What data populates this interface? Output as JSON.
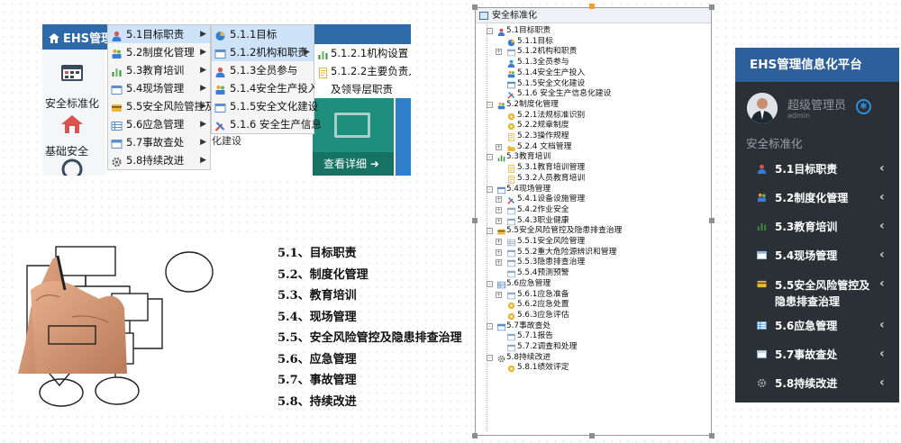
{
  "panel_menu": {
    "brand": "EHS管理",
    "nav": [
      {
        "label": "安全标准化",
        "icon": "calendar-icon"
      },
      {
        "label": "基础安全",
        "icon": "home-icon"
      }
    ],
    "menu_level1": [
      {
        "label": "5.1目标职责",
        "icon": "person-icon",
        "highlight": true
      },
      {
        "label": "5.2制度化管理",
        "icon": "people-icon",
        "highlight": false
      },
      {
        "label": "5.3教育培训",
        "icon": "bar-chart-icon",
        "highlight": false
      },
      {
        "label": "5.4现场管理",
        "icon": "window-icon",
        "highlight": false
      },
      {
        "label": "5.5安全风险管控及",
        "icon": "card-icon",
        "highlight": false
      },
      {
        "label": "5.6应急管理",
        "icon": "table-icon",
        "highlight": false
      },
      {
        "label": "5.7事故查处",
        "icon": "list-icon",
        "highlight": false
      },
      {
        "label": "5.8持续改进",
        "icon": "gear-icon",
        "highlight": false
      }
    ],
    "menu_level2": [
      {
        "label": "5.1.1目标",
        "icon": "pie-icon"
      },
      {
        "label": "5.1.2机构和职责",
        "icon": "window-icon"
      },
      {
        "label": "5.1.3全员参与",
        "icon": "person-icon"
      },
      {
        "label": "5.1.4安全生产投入",
        "icon": "people-icon"
      },
      {
        "label": "5.1.5安全文化建设",
        "icon": "window-icon"
      },
      {
        "label": "5.1.6 安全生产信息",
        "icon": "tools-icon"
      }
    ],
    "menu_level3": [
      {
        "label": "5.1.2.1机构设置",
        "icon": "bar-chart-icon"
      },
      {
        "label": "5.1.2.2主要负责人",
        "icon": "document-icon"
      },
      {
        "label": "及领导层职责",
        "icon": ""
      }
    ],
    "tile_footer": "查看详细",
    "overflow_text": "化建设"
  },
  "steps": [
    "5.1、目标职责",
    "5.2、制度化管理",
    "5.3、教育培训",
    "5.4、现场管理",
    "5.5、安全风险管控及隐患排查治理",
    "5.6、应急管理",
    "5.7、事故管理",
    "5.8、持续改进"
  ],
  "tree": {
    "root": "安全标准化",
    "nodes": [
      {
        "label": "5.1目标职责",
        "level": 1,
        "expand": "-",
        "icon": "person-icon",
        "color": "#d9534f"
      },
      {
        "label": "5.1.1目标",
        "level": 2,
        "expand": "",
        "icon": "pie-icon",
        "color": "#2f7fd0"
      },
      {
        "label": "5.1.2机构和职责",
        "level": 2,
        "expand": "+",
        "icon": "window-icon",
        "color": "#8fa9c8"
      },
      {
        "label": "5.1.3全员参与",
        "level": 2,
        "expand": "",
        "icon": "person-icon",
        "color": "#3a9ad9"
      },
      {
        "label": "5.1.4安全生产投入",
        "level": 2,
        "expand": "",
        "icon": "people-icon",
        "color": "#e0a32e"
      },
      {
        "label": "5.1.5安全文化建设",
        "level": 2,
        "expand": "",
        "icon": "window-icon",
        "color": "#5b8fc9"
      },
      {
        "label": "5.1.6 安全生产信息化建设",
        "level": 2,
        "expand": "",
        "icon": "tools-icon",
        "color": "#d84b3a"
      },
      {
        "label": "5.2制度化管理",
        "level": 1,
        "expand": "-",
        "icon": "people-icon",
        "color": "#e0a32e"
      },
      {
        "label": "5.2.1法规标准识别",
        "level": 2,
        "expand": "",
        "icon": "disc-icon",
        "color": "#e8b83a"
      },
      {
        "label": "5.2.2规章制度",
        "level": 2,
        "expand": "",
        "icon": "disc-icon",
        "color": "#e8b83a"
      },
      {
        "label": "5.2.3操作规程",
        "level": 2,
        "expand": "",
        "icon": "document-icon",
        "color": "#e8b83a"
      },
      {
        "label": "5.2.4 文档管理",
        "level": 2,
        "expand": "+",
        "icon": "folder-icon",
        "color": "#e8b83a"
      },
      {
        "label": "5.3教育培训",
        "level": 1,
        "expand": "-",
        "icon": "bar-chart-icon",
        "color": "#3c8d3c"
      },
      {
        "label": "5.3.1教育培训管理",
        "level": 2,
        "expand": "",
        "icon": "document-icon",
        "color": "#e8b83a"
      },
      {
        "label": "5.3.2人员教育培训",
        "level": 2,
        "expand": "",
        "icon": "document-icon",
        "color": "#e8b83a"
      },
      {
        "label": "5.4现场管理",
        "level": 1,
        "expand": "-",
        "icon": "window-icon",
        "color": "#5b8fc9"
      },
      {
        "label": "5.4.1设备设施管理",
        "level": 2,
        "expand": "+",
        "icon": "tools-icon",
        "color": "#d84b3a"
      },
      {
        "label": "5.4.2作业安全",
        "level": 2,
        "expand": "+",
        "icon": "window-icon",
        "color": "#8fa9c8"
      },
      {
        "label": "5.4.3职业健康",
        "level": 2,
        "expand": "+",
        "icon": "window-icon",
        "color": "#8fa9c8"
      },
      {
        "label": "5.5安全风险管控及隐患排查治理",
        "level": 1,
        "expand": "-",
        "icon": "card-icon",
        "color": "#e8b83a"
      },
      {
        "label": "5.5.1安全风险管理",
        "level": 2,
        "expand": "+",
        "icon": "table-icon",
        "color": "#8fa9c8"
      },
      {
        "label": "5.5.2重大危险源辨识和管理",
        "level": 2,
        "expand": "+",
        "icon": "window-icon",
        "color": "#8fa9c8"
      },
      {
        "label": "5.5.3隐患排查治理",
        "level": 2,
        "expand": "+",
        "icon": "window-icon",
        "color": "#8fa9c8"
      },
      {
        "label": "5.5.4预测预警",
        "level": 2,
        "expand": "",
        "icon": "window-icon",
        "color": "#8fa9c8"
      },
      {
        "label": "5.6应急管理",
        "level": 1,
        "expand": "-",
        "icon": "table-icon",
        "color": "#5b8fc9"
      },
      {
        "label": "5.6.1应急准备",
        "level": 2,
        "expand": "+",
        "icon": "window-icon",
        "color": "#8fa9c8"
      },
      {
        "label": "5.6.2应急处置",
        "level": 2,
        "expand": "",
        "icon": "disc-icon",
        "color": "#e8b83a"
      },
      {
        "label": "5.6.3应急评估",
        "level": 2,
        "expand": "",
        "icon": "disc-icon",
        "color": "#e8b83a"
      },
      {
        "label": "5.7事故查处",
        "level": 1,
        "expand": "-",
        "icon": "list-icon",
        "color": "#5b8fc9"
      },
      {
        "label": "5.7.1报告",
        "level": 2,
        "expand": "",
        "icon": "window-icon",
        "color": "#8fa9c8"
      },
      {
        "label": "5.7.2调查和处理",
        "level": 2,
        "expand": "",
        "icon": "window-icon",
        "color": "#8fa9c8"
      },
      {
        "label": "5.8持续改进",
        "level": 1,
        "expand": "-",
        "icon": "gear-icon",
        "color": "#666666"
      },
      {
        "label": "5.8.1绩效评定",
        "level": 2,
        "expand": "",
        "icon": "disc-icon",
        "color": "#e8b83a"
      }
    ]
  },
  "sidebar": {
    "title": "EHS管理信息化平台",
    "user_name": "超级管理员",
    "user_role": "admin",
    "section": "安全标准化",
    "items": [
      {
        "label": "5.1目标职责",
        "icon": "person-icon",
        "color": "#d9534f",
        "lines": 1
      },
      {
        "label": "5.2制度化管理",
        "icon": "people-icon",
        "color": "#e0a32e",
        "lines": 1
      },
      {
        "label": "5.3教育培训",
        "icon": "bar-chart-icon",
        "color": "#3c8d3c",
        "lines": 1
      },
      {
        "label": "5.4现场管理",
        "icon": "window-icon",
        "color": "#8fb3da",
        "lines": 1
      },
      {
        "label": "5.5安全风险管控及隐患排查治理",
        "icon": "card-icon",
        "color": "#e8b83a",
        "lines": 2
      },
      {
        "label": "5.6应急管理",
        "icon": "table-icon",
        "color": "#4a86c5",
        "lines": 1
      },
      {
        "label": "5.7事故查处",
        "icon": "list-icon",
        "color": "#cfd6de",
        "lines": 1
      },
      {
        "label": "5.8持续改进",
        "icon": "gear-icon",
        "color": "#9aa1aa",
        "lines": 1
      }
    ]
  }
}
